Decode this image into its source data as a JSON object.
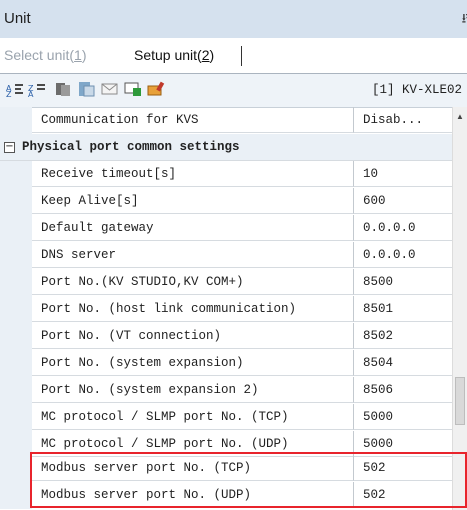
{
  "window": {
    "title": "Unit",
    "pin_glyph": "⭿"
  },
  "tabs": [
    {
      "label": "Select unit(",
      "key": "1",
      "suffix": ")"
    },
    {
      "label": "Setup unit(",
      "key": "2",
      "suffix": ")"
    }
  ],
  "toolbar": {
    "icons": [
      "sort-icon",
      "filter-icon",
      "copy-icon",
      "paste-icon",
      "mail-icon",
      "monitor-icon",
      "edit-icon"
    ],
    "unit_label": "[1] KV-XLE02"
  },
  "grid": {
    "top_row": {
      "name": "Communication for KVS",
      "value": "Disab..."
    },
    "section": {
      "toggle": "−",
      "label": "Physical port common settings"
    },
    "rows": [
      {
        "name": "Receive timeout[s]",
        "value": "10"
      },
      {
        "name": "Keep Alive[s]",
        "value": "600"
      },
      {
        "name": "Default gateway",
        "value": "0.0.0.0"
      },
      {
        "name": "DNS server",
        "value": "0.0.0.0"
      },
      {
        "name": "Port No.(KV STUDIO,KV COM+)",
        "value": "8500"
      },
      {
        "name": "Port No. (host link communication)",
        "value": "8501"
      },
      {
        "name": "Port No. (VT connection)",
        "value": "8502"
      },
      {
        "name": "Port No. (system expansion)",
        "value": "8504"
      },
      {
        "name": "Port No. (system expansion 2)",
        "value": "8506"
      },
      {
        "name": "MC protocol / SLMP port No. (TCP)",
        "value": "5000"
      },
      {
        "name": "MC protocol / SLMP port No. (UDP)",
        "value": "5000"
      },
      {
        "name": "Modbus server port No. (TCP)",
        "value": "502"
      },
      {
        "name": "Modbus server port No. (UDP)",
        "value": "502"
      }
    ]
  },
  "colors": {
    "titlebar": "#d5e1ee",
    "gutter": "#eaf0f6",
    "highlight": "#e8242c"
  }
}
